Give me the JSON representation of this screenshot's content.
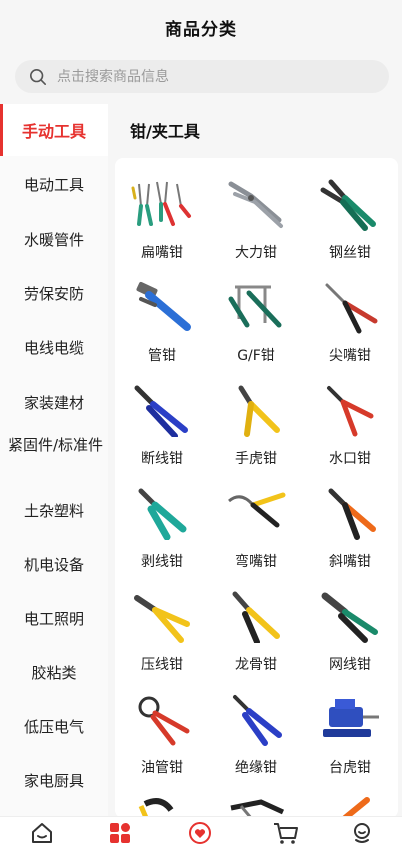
{
  "header": {
    "title": "商品分类"
  },
  "search": {
    "placeholder": "点击搜索商品信息"
  },
  "tabs": [
    {
      "label": "手动工具",
      "active": true
    },
    {
      "label": "钳/夹工具",
      "active": false
    }
  ],
  "sidebar": {
    "items": [
      "电动工具",
      "水暖管件",
      "劳保安防",
      "电线电缆",
      "家装建材",
      "紧固件/标准件",
      "土杂塑料",
      "机电设备",
      "电工照明",
      "胶粘类",
      "低压电气",
      "家电厨具"
    ]
  },
  "products": [
    {
      "label": "扁嘴钳",
      "icon": "flat-nose-pliers-set-icon"
    },
    {
      "label": "大力钳",
      "icon": "locking-pliers-icon"
    },
    {
      "label": "钢丝钳",
      "icon": "combination-pliers-icon"
    },
    {
      "label": "管钳",
      "icon": "pipe-wrench-icon"
    },
    {
      "label": "G/F钳",
      "icon": "f-clamp-icon"
    },
    {
      "label": "尖嘴钳",
      "icon": "needle-nose-pliers-icon"
    },
    {
      "label": "断线钳",
      "icon": "wire-cutter-icon"
    },
    {
      "label": "手虎钳",
      "icon": "hand-vise-icon"
    },
    {
      "label": "水口钳",
      "icon": "flush-cutter-icon"
    },
    {
      "label": "剥线钳",
      "icon": "wire-stripper-icon"
    },
    {
      "label": "弯嘴钳",
      "icon": "bent-nose-pliers-icon"
    },
    {
      "label": "斜嘴钳",
      "icon": "diagonal-pliers-icon"
    },
    {
      "label": "压线钳",
      "icon": "crimping-pliers-icon"
    },
    {
      "label": "龙骨钳",
      "icon": "keel-pliers-icon"
    },
    {
      "label": "网线钳",
      "icon": "network-crimper-icon"
    },
    {
      "label": "油管钳",
      "icon": "oil-pipe-pliers-icon"
    },
    {
      "label": "绝缘钳",
      "icon": "insulated-pliers-icon"
    },
    {
      "label": "台虎钳",
      "icon": "bench-vise-icon"
    }
  ],
  "bottom_nav": [
    "home-icon",
    "category-icon",
    "heart-chat-icon",
    "cart-icon",
    "profile-icon"
  ],
  "colors": {
    "accent": "#e6322f",
    "handle_green": "#1a8a6a",
    "handle_blue": "#2b4bd6",
    "handle_yellow": "#f2c31a",
    "handle_red": "#d63a2a"
  }
}
